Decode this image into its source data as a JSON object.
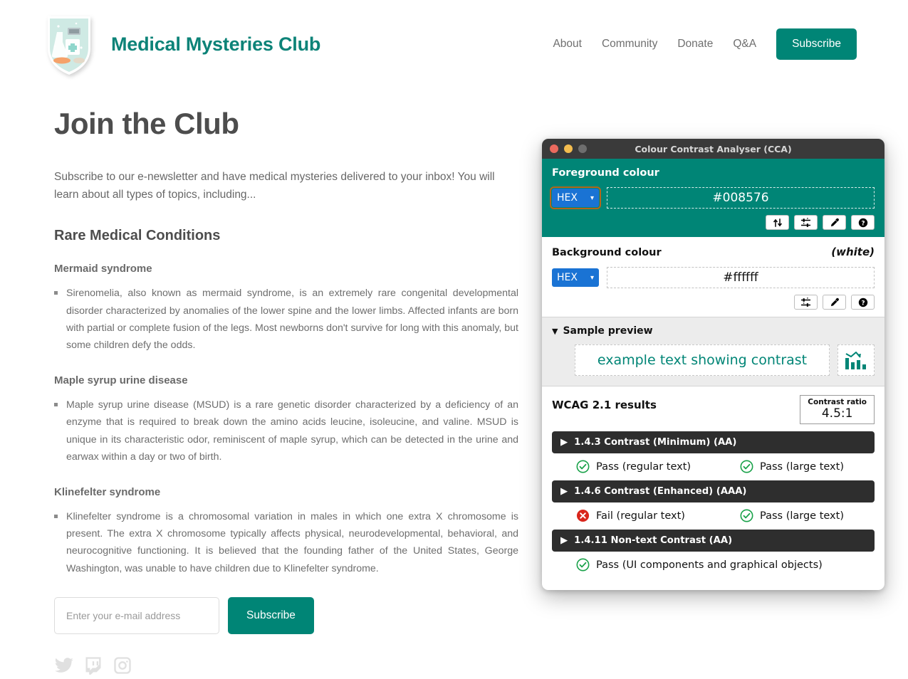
{
  "site": {
    "brand_name": "Medical Mysteries Club",
    "logo_icon": "medical-shield-logo",
    "nav": [
      {
        "label": "About",
        "name": "about"
      },
      {
        "label": "Community",
        "name": "community"
      },
      {
        "label": "Donate",
        "name": "donate"
      },
      {
        "label": "Q&A",
        "name": "qa"
      }
    ],
    "nav_subscribe_label": "Subscribe",
    "accent_color": "#008576",
    "brand_color": "#0d8378"
  },
  "main": {
    "page_title": "Join the Club",
    "intro": "Subscribe to our e-newsletter and have medical mysteries delivered to your inbox! You will learn about all types of topics, including...",
    "section_title": "Rare Medical Conditions",
    "entries": [
      {
        "title": "Mermaid syndrome",
        "body": "Sirenomelia, also known as mermaid syndrome, is an extremely rare congenital developmental disorder characterized by anomalies of the lower spine and the lower limbs. Affected infants are born with partial or complete fusion of the legs. Most newborns don't survive for long with this anomaly, but some children defy the odds."
      },
      {
        "title": "Maple syrup urine disease",
        "body": "Maple syrup urine disease (MSUD) is a rare genetic disorder characterized by a deficiency of an enzyme that is required to break down the amino acids leucine, isoleucine, and valine. MSUD is unique in its characteristic odor, reminiscent of maple syrup, which can be detected in the urine and earwax within a day or two of birth."
      },
      {
        "title": "Klinefelter syndrome",
        "body": "Klinefelter syndrome is a chromosomal variation in males in which one extra X chromosome is present. The extra X chromosome typically affects physical, neurodevelopmental, behavioral, and neurocognitive functioning. It is believed that the founding father of the United States, George Washington, was unable to have children due to Klinefelter syndrome."
      }
    ],
    "signup": {
      "email_placeholder": "Enter your e-mail address",
      "email_value": "",
      "subscribe_label": "Subscribe"
    },
    "socials": [
      {
        "name": "twitter-icon"
      },
      {
        "name": "twitch-icon"
      },
      {
        "name": "instagram-icon"
      }
    ]
  },
  "cca": {
    "window_title": "Colour Contrast Analyser (CCA)",
    "foreground": {
      "label": "Foreground colour",
      "format": "HEX",
      "value": "#008576",
      "tools": [
        "swap-icon",
        "sliders-icon",
        "eyedropper-icon",
        "help-icon"
      ]
    },
    "background": {
      "label": "Background colour",
      "note": "(white)",
      "format": "HEX",
      "value": "#ffffff",
      "tools": [
        "sliders-icon",
        "eyedropper-icon",
        "help-icon"
      ]
    },
    "preview": {
      "heading": "Sample preview",
      "sample_text": "example text showing contrast",
      "graphic_icon": "bar-chart-declining-icon"
    },
    "results": {
      "title": "WCAG 2.1 results",
      "ratio_label": "Contrast ratio",
      "ratio_value": "4.5:1",
      "criteria": [
        {
          "name": "1.4.3 Contrast (Minimum) (AA)",
          "results": [
            {
              "status": "pass",
              "text": "Pass (regular text)"
            },
            {
              "status": "pass",
              "text": "Pass (large text)"
            }
          ]
        },
        {
          "name": "1.4.6 Contrast (Enhanced) (AAA)",
          "results": [
            {
              "status": "fail",
              "text": "Fail (regular text)"
            },
            {
              "status": "pass",
              "text": "Pass (large text)"
            }
          ]
        },
        {
          "name": "1.4.11 Non-text Contrast (AA)",
          "results": [
            {
              "status": "pass",
              "text": "Pass (UI components and graphical objects)"
            }
          ]
        }
      ],
      "pass_color": "#1aa24a",
      "fail_color": "#d9261c"
    }
  }
}
